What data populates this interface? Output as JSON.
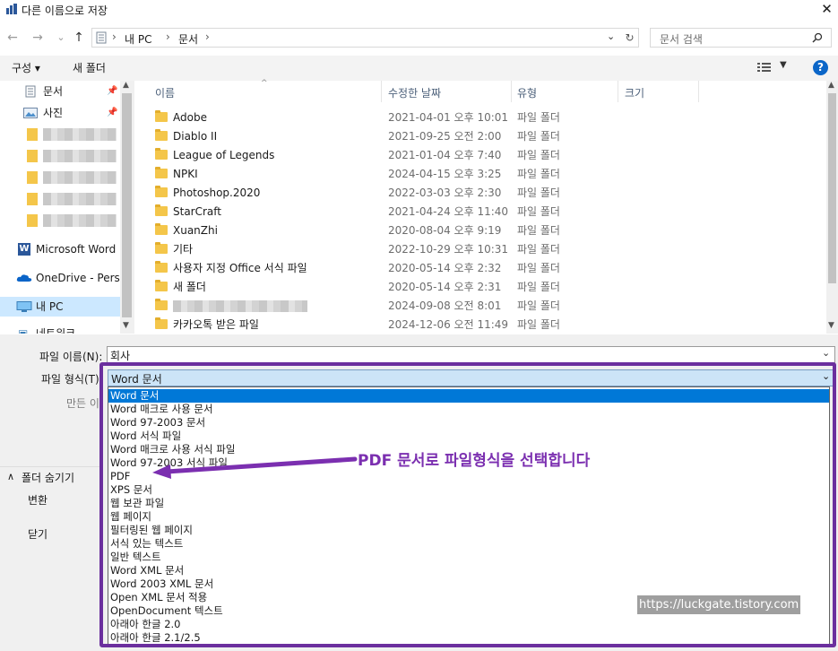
{
  "window": {
    "title": "다른 이름으로 저장",
    "close_glyph": "✕"
  },
  "nav": {
    "back_glyph": "←",
    "forward_glyph": "→",
    "recent_glyph": "⌄",
    "up_glyph": "↑",
    "breadcrumb": [
      "내 PC",
      "문서"
    ],
    "separator": "›",
    "search_placeholder": "문서 검색"
  },
  "toolbar": {
    "organize": "구성 ▾",
    "new_folder": "새 폴더"
  },
  "sidebar": {
    "items": [
      "문서",
      "사진",
      "Microsoft Word",
      "OneDrive - Person",
      "내 PC",
      "네트워크"
    ]
  },
  "columns": {
    "name": "이름",
    "modified": "수정한 날짜",
    "type": "유형",
    "size": "크기"
  },
  "files": [
    {
      "name": "Adobe",
      "modified": "2021-04-01 오후 10:01",
      "type": "파일 폴더"
    },
    {
      "name": "Diablo II",
      "modified": "2021-09-25 오전 2:00",
      "type": "파일 폴더"
    },
    {
      "name": "League of Legends",
      "modified": "2021-01-04 오후 7:40",
      "type": "파일 폴더"
    },
    {
      "name": "NPKI",
      "modified": "2024-04-15 오후 3:25",
      "type": "파일 폴더"
    },
    {
      "name": "Photoshop.2020",
      "modified": "2022-03-03 오후 2:30",
      "type": "파일 폴더"
    },
    {
      "name": "StarCraft",
      "modified": "2021-04-24 오후 11:40",
      "type": "파일 폴더"
    },
    {
      "name": "XuanZhi",
      "modified": "2020-08-04 오후 9:19",
      "type": "파일 폴더"
    },
    {
      "name": "기타",
      "modified": "2022-10-29 오후 10:31",
      "type": "파일 폴더"
    },
    {
      "name": "사용자 지정 Office 서식 파일",
      "modified": "2020-05-14 오후 2:32",
      "type": "파일 폴더"
    },
    {
      "name": "새 폴더",
      "modified": "2020-05-14 오후 2:31",
      "type": "파일 폴더"
    },
    {
      "name": "",
      "modified": "2024-09-08 오전 8:01",
      "type": "파일 폴더"
    },
    {
      "name": "카카오톡 받은 파일",
      "modified": "2024-12-06 오전 11:49",
      "type": "파일 폴더"
    }
  ],
  "form": {
    "filename_label": "파일 이름(N):",
    "filename_value": "회사",
    "filetype_label": "파일 형식(T):",
    "filetype_value": "Word 문서",
    "author_label": "만든 이",
    "hide_folders": "폴더 숨기기",
    "convert": "변환",
    "close": "닫기"
  },
  "filetype_options": [
    "Word 문서",
    "Word 매크로 사용 문서",
    "Word 97-2003 문서",
    "Word 서식 파일",
    "Word 매크로 사용 서식 파일",
    "Word 97-2003 서식 파일",
    "PDF",
    "XPS 문서",
    "웹 보관 파일",
    "웹 페이지",
    "필터링된 웹 페이지",
    "서식 있는 텍스트",
    "일반 텍스트",
    "Word XML 문서",
    "Word 2003 XML 문서",
    "Open XML 문서 적용",
    "OpenDocument 텍스트",
    "아래아 한글 2.0",
    "아래아 한글 2.1/2.5"
  ],
  "annotation": "PDF 문서로 파일형식을 선택합니다",
  "watermark": "https://luckgate.tistory.com",
  "colors": {
    "accent": "#0078d7",
    "annotation_purple": "#6b2f9e",
    "folder": "#f4c64a"
  }
}
